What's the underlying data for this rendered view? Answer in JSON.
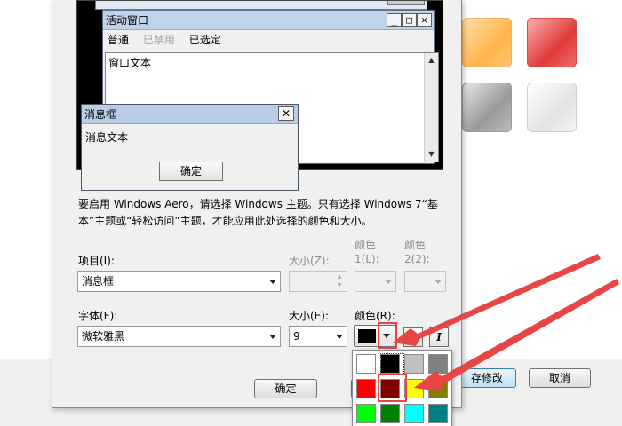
{
  "preview": {
    "active_window": {
      "title": "活动窗口",
      "menu": [
        "普通",
        "已禁用",
        "已选定"
      ],
      "body_text": "窗口文本"
    },
    "message_box": {
      "title": "消息框",
      "body_text": "消息文本",
      "ok_label": "确定"
    }
  },
  "info_text": "要启用 Windows Aero，请选择 Windows 主题。只有选择 Windows 7“基本”主题或“轻松访问”主题，才能应用此处选择的颜色和大小。",
  "item": {
    "label": "项目(I):",
    "value": "消息框"
  },
  "item_size": {
    "label": "大小(Z):"
  },
  "item_color1": {
    "label_top": "颜色",
    "label_bottom": "1(L):"
  },
  "item_color2": {
    "label_top": "颜色",
    "label_bottom": "2(2):"
  },
  "font": {
    "label": "字体(F):",
    "value": "微软雅黑"
  },
  "font_size": {
    "label": "大小(E):",
    "value": "9"
  },
  "font_color": {
    "label": "颜色(R):",
    "current": "#000000"
  },
  "format": {
    "bold": "B",
    "italic": "I"
  },
  "dialog_buttons": {
    "ok": "确定",
    "cancel_fragment": "取"
  },
  "background": {
    "save_label": "存修改",
    "cancel_label": "取消",
    "swatches": [
      "#ffb54a",
      "#e03a3a",
      "#9a9a9a",
      "#f4f4f4"
    ]
  },
  "palette": {
    "colors": [
      "#ffffff",
      "#000000",
      "#c0c0c0",
      "#808080",
      "#ff0000",
      "#800000",
      "#ffff00",
      "#808000",
      "#00ff00",
      "#008000",
      "#00ffff",
      "#008080"
    ],
    "selected": "#800000"
  },
  "annotation": {
    "color": "#e84545"
  }
}
